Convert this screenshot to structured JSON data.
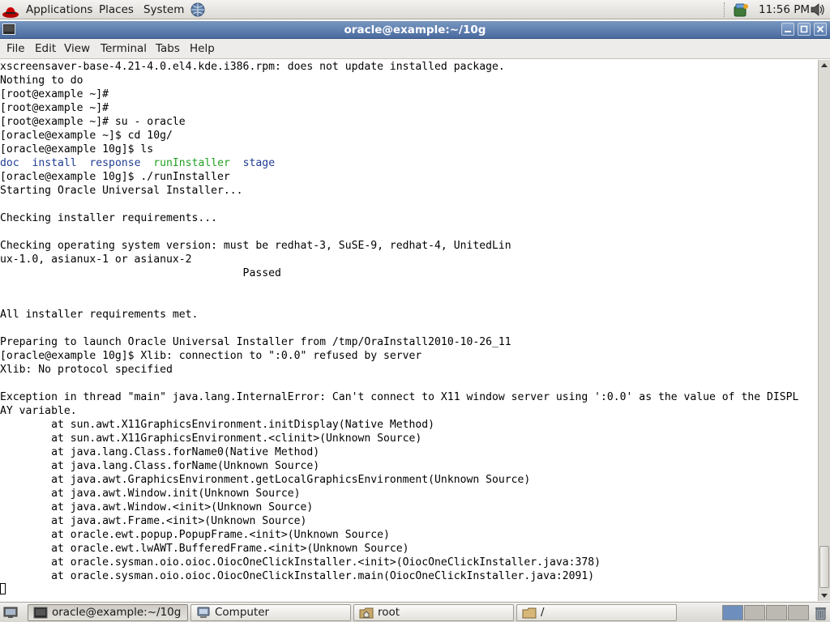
{
  "top_panel": {
    "applications": "Applications",
    "places": "Places",
    "system": "System",
    "clock": "11:56 PM",
    "icons": [
      "redhat-icon",
      "network-icon",
      "updates-icon",
      "volume-icon"
    ]
  },
  "window": {
    "title": "oracle@example:~/10g",
    "buttons": [
      "minimize-icon",
      "maximize-icon",
      "close-icon"
    ],
    "title_bar_color": "#5a7aac"
  },
  "menubar": {
    "file": "File",
    "edit": "Edit",
    "view": "View",
    "terminal": "Terminal",
    "tabs": "Tabs",
    "help": "Help"
  },
  "terminal": {
    "lines": [
      "xscreensaver-base-4.21-4.0.el4.kde.i386.rpm: does not update installed package.",
      "Nothing to do",
      "[root@example ~]#",
      "[root@example ~]#",
      "[root@example ~]# su - oracle",
      "[oracle@example ~]$ cd 10g/",
      "[oracle@example 10g]$ ls",
      "",
      "[oracle@example 10g]$ ./runInstaller",
      "Starting Oracle Universal Installer...",
      "",
      "Checking installer requirements...",
      "",
      "Checking operating system version: must be redhat-3, SuSE-9, redhat-4, UnitedLin",
      "ux-1.0, asianux-1 or asianux-2",
      "                                      Passed",
      "",
      "",
      "All installer requirements met.",
      "",
      "Preparing to launch Oracle Universal Installer from /tmp/OraInstall2010-10-26_11",
      "[oracle@example 10g]$ Xlib: connection to \":0.0\" refused by server",
      "Xlib: No protocol specified",
      "",
      "Exception in thread \"main\" java.lang.InternalError: Can't connect to X11 window server using ':0.0' as the value of the DISPL",
      "AY variable.",
      "        at sun.awt.X11GraphicsEnvironment.initDisplay(Native Method)",
      "        at sun.awt.X11GraphicsEnvironment.<clinit>(Unknown Source)",
      "        at java.lang.Class.forName0(Native Method)",
      "        at java.lang.Class.forName(Unknown Source)",
      "        at java.awt.GraphicsEnvironment.getLocalGraphicsEnvironment(Unknown Source)",
      "        at java.awt.Window.init(Unknown Source)",
      "        at java.awt.Window.<init>(Unknown Source)",
      "        at java.awt.Frame.<init>(Unknown Source)",
      "        at oracle.ewt.popup.PopupFrame.<init>(Unknown Source)",
      "        at oracle.ewt.lwAWT.BufferedFrame.<init>(Unknown Source)",
      "        at oracle.sysman.oio.oioc.OiocOneClickInstaller.<init>(OiocOneClickInstaller.java:378)",
      "        at oracle.sysman.oio.oioc.OiocOneClickInstaller.main(OiocOneClickInstaller.java:2091)"
    ],
    "ls_output": [
      {
        "name": "doc",
        "kind": "dir"
      },
      {
        "name": "install",
        "kind": "dir"
      },
      {
        "name": "response",
        "kind": "dir"
      },
      {
        "name": "runInstaller",
        "kind": "exec"
      },
      {
        "name": "stage",
        "kind": "dir"
      }
    ],
    "ls_line_index": 7,
    "colors": {
      "dir": "#1f3c92",
      "exec": "#22a022"
    }
  },
  "taskbar": {
    "items": [
      {
        "label": "oracle@example:~/10g",
        "icon": "terminal-icon",
        "active": true
      },
      {
        "label": "Computer",
        "icon": "computer-icon",
        "active": false
      },
      {
        "label": "root",
        "icon": "home-folder-icon",
        "active": false
      },
      {
        "label": "/",
        "icon": "folder-icon",
        "active": false
      }
    ],
    "workspaces": 4,
    "active_workspace": 1
  }
}
